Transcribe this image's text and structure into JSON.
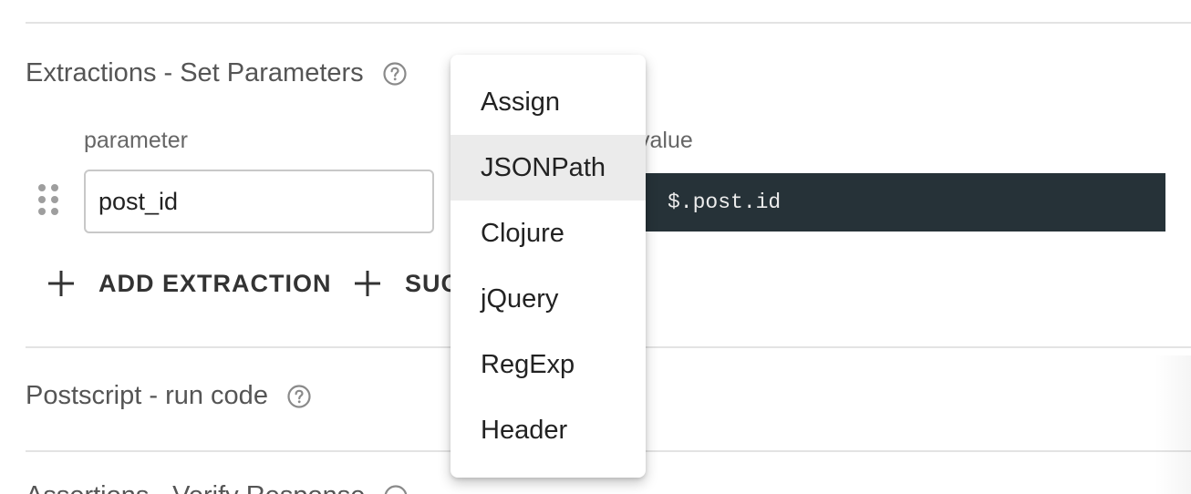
{
  "extractions": {
    "title": "Extractions - Set Parameters",
    "parameter_label": "parameter",
    "value_label": "value",
    "row": {
      "parameter_value": "post_id",
      "value_code": "$.post.id"
    },
    "add_extraction_label": "ADD EXTRACTION",
    "suggest_label": "SUG"
  },
  "postscript": {
    "title": "Postscript - run code"
  },
  "assertions": {
    "title": "Assertions - Verify Response"
  },
  "dropdown": {
    "items": [
      {
        "label": "Assign",
        "selected": false
      },
      {
        "label": "JSONPath",
        "selected": true
      },
      {
        "label": "Clojure",
        "selected": false
      },
      {
        "label": "jQuery",
        "selected": false
      },
      {
        "label": "RegExp",
        "selected": false
      },
      {
        "label": "Header",
        "selected": false
      }
    ]
  },
  "colors": {
    "editor_bg": "#263238",
    "selected_item_bg": "#ebebeb",
    "divider": "#e3e3e3"
  },
  "icons": {
    "help": "help-circle-icon",
    "drag": "drag-handle-icon",
    "add": "plus-icon"
  }
}
